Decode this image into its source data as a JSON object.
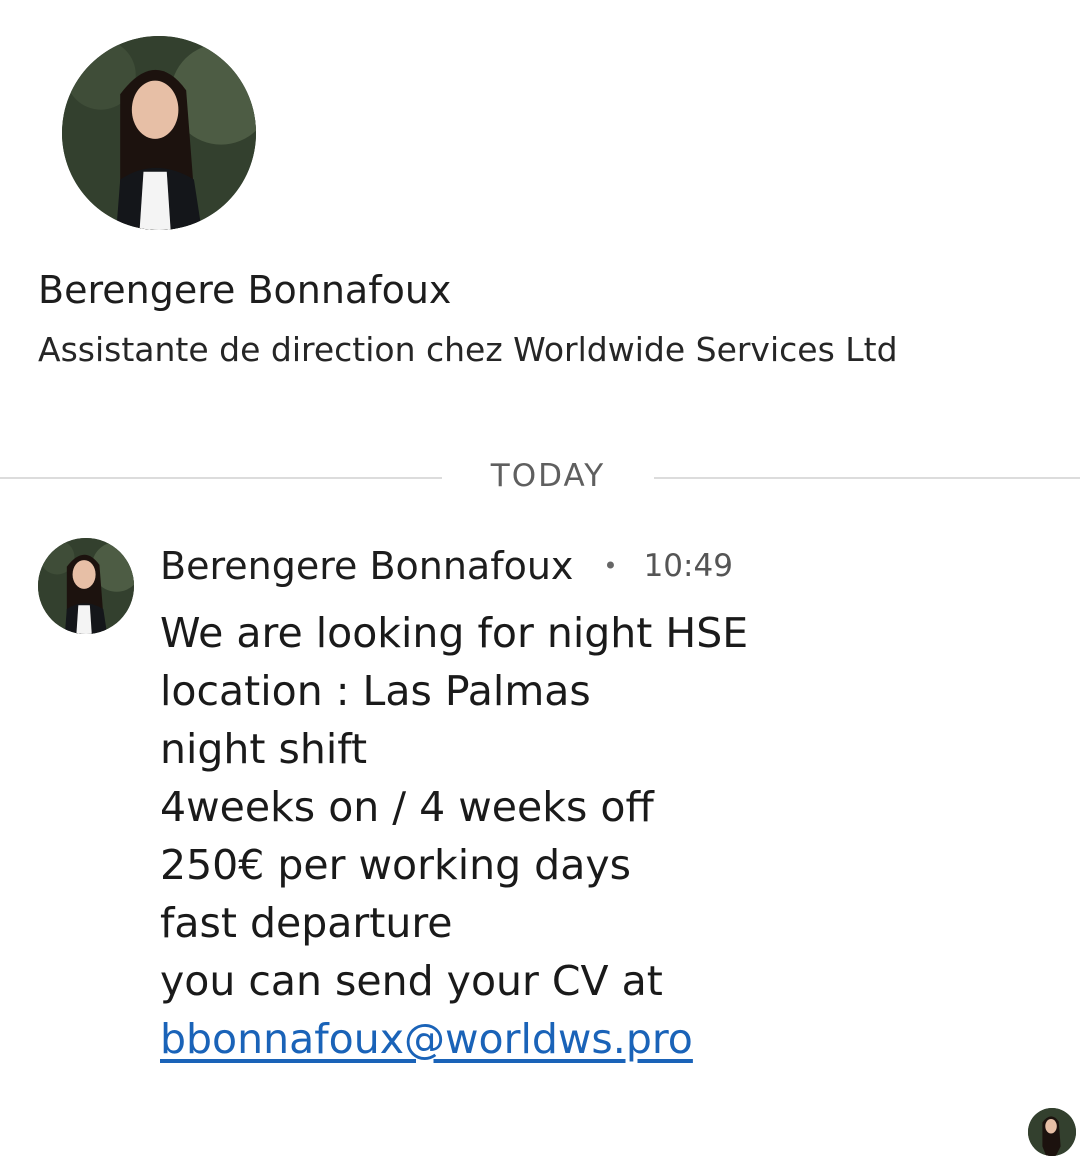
{
  "profile": {
    "name": "Berengere Bonnafoux",
    "headline": "Assistante de direction chez Worldwide Services Ltd"
  },
  "date_divider": "TODAY",
  "message": {
    "sender": "Berengere Bonnafoux",
    "separator": "•",
    "time": "10:49",
    "lines": [
      "We are looking for night HSE",
      "location : Las Palmas",
      "night shift",
      "4weeks on / 4 weeks off",
      "250€ per working days",
      "fast departure",
      "you can send your CV at"
    ],
    "email_link": "bbonnafoux@worldws.pro"
  }
}
